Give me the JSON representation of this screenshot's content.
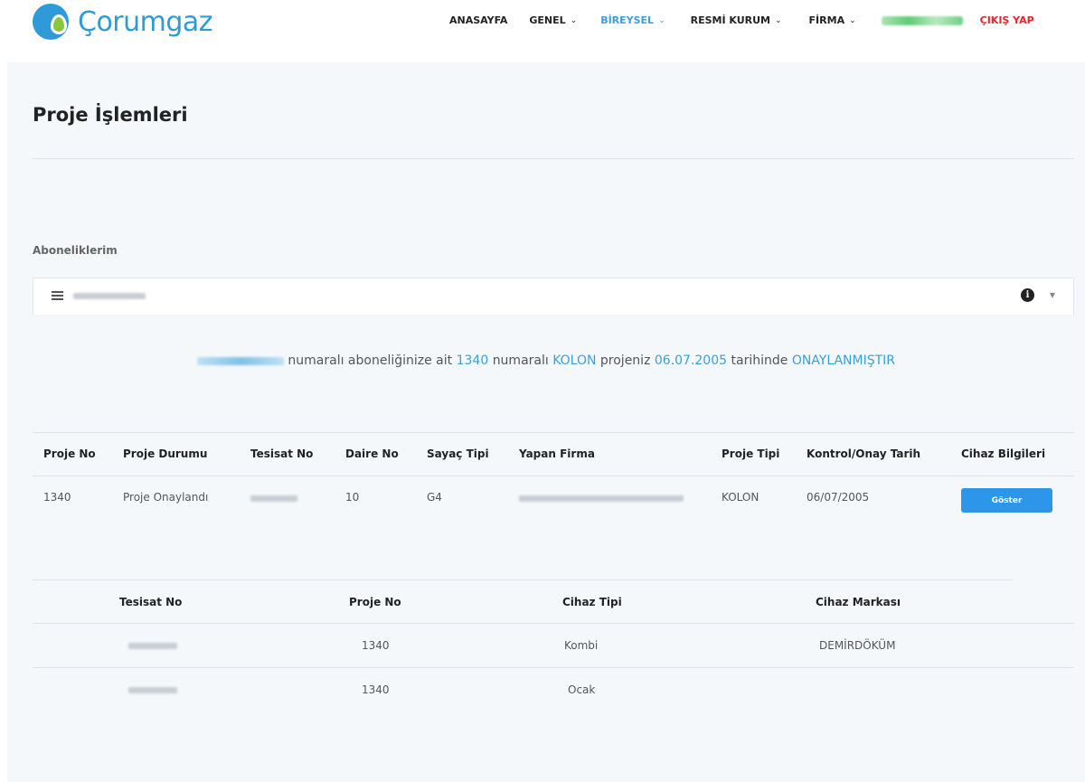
{
  "header": {
    "brand": "Çorumgaz",
    "nav": [
      {
        "label": "ANASAYFA",
        "has_dropdown": false,
        "active": false
      },
      {
        "label": "GENEL",
        "has_dropdown": true,
        "active": false
      },
      {
        "label": "BİREYSEL",
        "has_dropdown": true,
        "active": true
      },
      {
        "label": "RESMİ KURUM",
        "has_dropdown": true,
        "active": false
      },
      {
        "label": "FİRMA",
        "has_dropdown": true,
        "active": false
      }
    ],
    "logout": "ÇIKIŞ YAP"
  },
  "page": {
    "title": "Proje İşlemleri",
    "subscriptions_label": "Aboneliklerim"
  },
  "notice": {
    "text_1": "numaralı aboneliğinize ait",
    "project_no": "1340",
    "text_2": "numaralı",
    "project_type": "KOLON",
    "text_3": "projeniz",
    "date": "06.07.2005",
    "text_4": "tarihinde",
    "status": "ONAYLANMIŞTIR"
  },
  "project_table": {
    "headers": {
      "proje_no": "Proje No",
      "proje_durumu": "Proje Durumu",
      "tesisat_no": "Tesisat No",
      "daire_no": "Daire No",
      "sayac_tipi": "Sayaç Tipi",
      "yapan_firma": "Yapan Firma",
      "proje_tipi": "Proje Tipi",
      "kontrol_tarih": "Kontrol/Onay Tarih",
      "cihaz_bilgileri": "Cihaz Bilgileri"
    },
    "row": {
      "proje_no": "1340",
      "proje_durumu": "Proje Onaylandı",
      "daire_no": "10",
      "sayac_tipi": "G4",
      "proje_tipi": "KOLON",
      "kontrol_tarih": "06/07/2005",
      "button": "Göster"
    }
  },
  "device_table": {
    "headers": {
      "tesisat_no": "Tesisat No",
      "proje_no": "Proje No",
      "cihaz_tipi": "Cihaz Tipi",
      "cihaz_markasi": "Cihaz Markası"
    },
    "rows": [
      {
        "proje_no": "1340",
        "cihaz_tipi": "Kombi",
        "cihaz_markasi": "DEMİRDÖKÜM"
      },
      {
        "proje_no": "1340",
        "cihaz_tipi": "Ocak",
        "cihaz_markasi": ""
      }
    ]
  },
  "colors": {
    "accent": "#3aa0db",
    "button": "#2b96ea",
    "logout": "#e4262c",
    "logo_blue": "#2e9bd8",
    "logo_green": "#8cc63f",
    "background": "#f4f8fb"
  }
}
